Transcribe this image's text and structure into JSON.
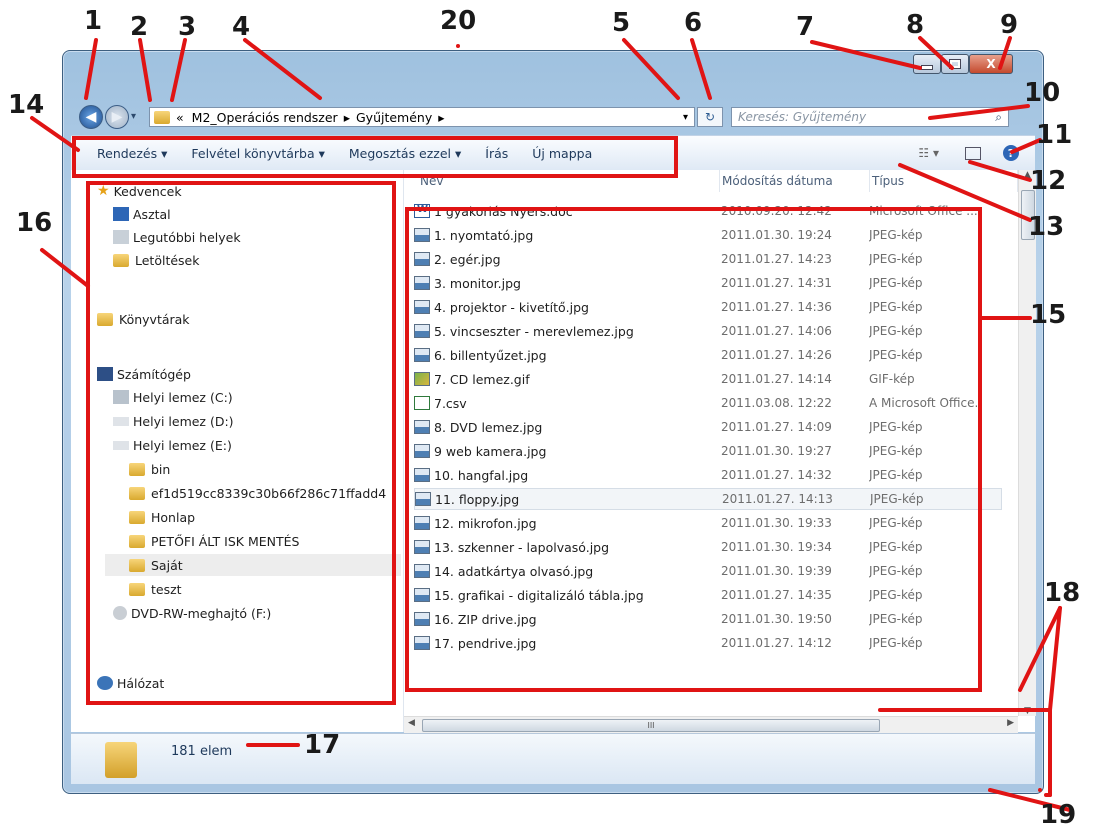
{
  "window": {
    "breadcrumb_parts": [
      "«",
      "M2_Operációs rendszer",
      "▸",
      "Gyűjtemény",
      "▸"
    ],
    "search_placeholder": "Keresés: Gyűjtemény",
    "close_label": "X"
  },
  "toolbar": {
    "organize": "Rendezés ▾",
    "include_library": "Felvétel könyvtárba ▾",
    "share": "Megosztás ezzel ▾",
    "burn": "Írás",
    "new_folder": "Új mappa"
  },
  "nav": {
    "favorites": "Kedvencek",
    "desktop": "Asztal",
    "recent": "Legutóbbi helyek",
    "downloads": "Letöltések",
    "libraries": "Könyvtárak",
    "computer": "Számítógép",
    "drive_c": "Helyi lemez (C:)",
    "drive_d": "Helyi lemez (D:)",
    "drive_e": "Helyi lemez (E:)",
    "folders": [
      "bin",
      "ef1d519cc8339c30b66f286c71ffadd4",
      "Honlap",
      "PETŐFI ÁLT ISK MENTÉS",
      "Saját",
      "teszt"
    ],
    "dvd": "DVD-RW-meghajtó (F:)",
    "network": "Hálózat"
  },
  "columns": {
    "name": "Név",
    "date": "Módosítás dátuma",
    "type": "Típus"
  },
  "files": [
    {
      "name": "1 gyakorlás Nyers.doc",
      "date": "2010.09.20. 12:42",
      "type": "Microsoft Office ...",
      "icon": "doc"
    },
    {
      "name": "1. nyomtató.jpg",
      "date": "2011.01.30. 19:24",
      "type": "JPEG-kép",
      "icon": "img"
    },
    {
      "name": "2. egér.jpg",
      "date": "2011.01.27. 14:23",
      "type": "JPEG-kép",
      "icon": "img"
    },
    {
      "name": "3. monitor.jpg",
      "date": "2011.01.27. 14:31",
      "type": "JPEG-kép",
      "icon": "img"
    },
    {
      "name": "4. projektor - kivetítő.jpg",
      "date": "2011.01.27. 14:36",
      "type": "JPEG-kép",
      "icon": "img"
    },
    {
      "name": "5. vincseszter - merevlemez.jpg",
      "date": "2011.01.27. 14:06",
      "type": "JPEG-kép",
      "icon": "img"
    },
    {
      "name": "6. billentyűzet.jpg",
      "date": "2011.01.27. 14:26",
      "type": "JPEG-kép",
      "icon": "img"
    },
    {
      "name": "7. CD lemez.gif",
      "date": "2011.01.27. 14:14",
      "type": "GIF-kép",
      "icon": "gif"
    },
    {
      "name": "7.csv",
      "date": "2011.03.08. 12:22",
      "type": "A Microsoft Office..",
      "icon": "csv"
    },
    {
      "name": "8. DVD lemez.jpg",
      "date": "2011.01.27. 14:09",
      "type": "JPEG-kép",
      "icon": "img"
    },
    {
      "name": "9 web kamera.jpg",
      "date": "2011.01.30. 19:27",
      "type": "JPEG-kép",
      "icon": "img"
    },
    {
      "name": "10. hangfal.jpg",
      "date": "2011.01.27. 14:32",
      "type": "JPEG-kép",
      "icon": "img"
    },
    {
      "name": "11. floppy.jpg",
      "date": "2011.01.27. 14:13",
      "type": "JPEG-kép",
      "icon": "img"
    },
    {
      "name": "12. mikrofon.jpg",
      "date": "2011.01.30. 19:33",
      "type": "JPEG-kép",
      "icon": "img"
    },
    {
      "name": "13. szkenner - lapolvasó.jpg",
      "date": "2011.01.30. 19:34",
      "type": "JPEG-kép",
      "icon": "img"
    },
    {
      "name": "14. adatkártya olvasó.jpg",
      "date": "2011.01.30. 19:39",
      "type": "JPEG-kép",
      "icon": "img"
    },
    {
      "name": "15. grafikai - digitalizáló tábla.jpg",
      "date": "2011.01.27. 14:35",
      "type": "JPEG-kép",
      "icon": "img"
    },
    {
      "name": "16. ZIP drive.jpg",
      "date": "2011.01.30. 19:50",
      "type": "JPEG-kép",
      "icon": "img"
    },
    {
      "name": "17. pendrive.jpg",
      "date": "2011.01.27. 14:12",
      "type": "JPEG-kép",
      "icon": "img"
    }
  ],
  "status": {
    "count": "181 elem"
  },
  "hscroll_thumb_label": "III",
  "callouts": [
    "1",
    "2",
    "3",
    "4",
    "5",
    "6",
    "7",
    "8",
    "9",
    "10",
    "11",
    "12",
    "13",
    "14",
    "15",
    "16",
    "17",
    "18",
    "19",
    "20"
  ],
  "colors": {
    "highlight": "#e01414",
    "accent": "#1e395b"
  }
}
